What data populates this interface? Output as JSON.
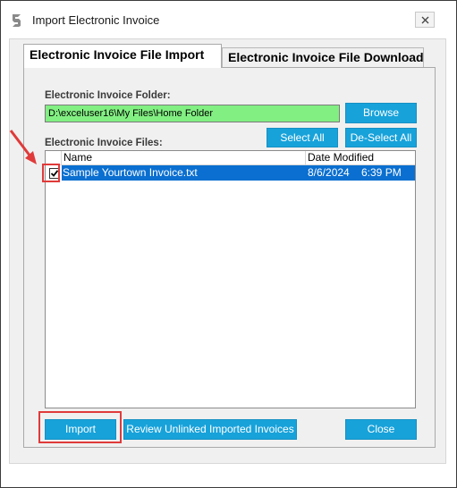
{
  "window": {
    "title": "Import Electronic Invoice"
  },
  "tabs": [
    {
      "label": "Electronic Invoice File Import",
      "active": true
    },
    {
      "label": "Electronic Invoice File Download",
      "active": false
    }
  ],
  "folder": {
    "label": "Electronic Invoice Folder:",
    "value": "D:\\exceluser16\\My Files\\Home Folder",
    "browse_label": "Browse"
  },
  "files": {
    "label": "Electronic Invoice Files:",
    "select_all_label": "Select All",
    "deselect_all_label": "De-Select All",
    "columns": [
      "Name",
      "Date Modified"
    ],
    "rows": [
      {
        "name": "Sample Yourtown Invoice.txt",
        "date": "8/6/2024",
        "time": "6:39 PM",
        "checked": true,
        "selected": true
      }
    ]
  },
  "buttons": {
    "import_label": "Import",
    "review_label": "Review Unlinked Imported Invoices",
    "close_label": "Close"
  },
  "colors": {
    "accent": "#17a2da",
    "selection": "#0a6fd0",
    "folder_bg": "#82ef82",
    "annotation": "#e03a3a"
  }
}
